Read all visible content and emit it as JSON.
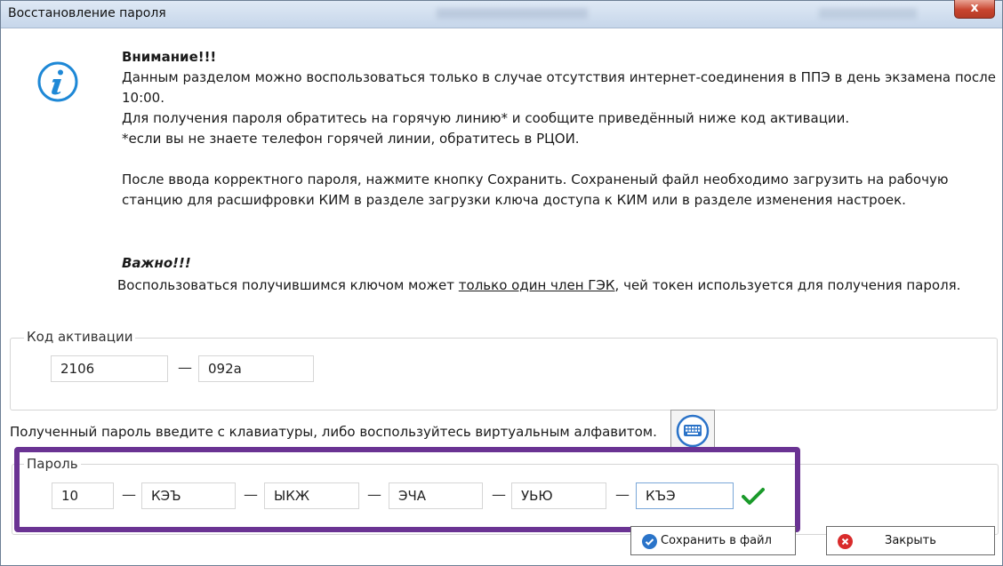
{
  "window": {
    "title": "Восстановление пароля",
    "close_glyph": "x"
  },
  "notice": {
    "heading": "Внимание!!!",
    "line1": "Данным разделом можно воспользоваться только в случае отсутствия интернет-соединения в ППЭ в день экзамена после",
    "line2": "10:00.",
    "line3": "Для получения пароля обратитесь на горячую линию* и сообщите приведённый ниже код активации.",
    "line4": "*если вы не знаете телефон горячей линии, обратитесь в РЦОИ.",
    "line5": "После ввода корректного пароля, нажмите кнопку Сохранить. Сохраненый файл необходимо загрузить на рабочую",
    "line6": "станцию для расшифровки КИМ в разделе загрузки ключа доступа к КИМ или в разделе изменения настроек.",
    "important_heading": "Важно!!!",
    "important_pre": "Воспользоваться получившимся ключом может ",
    "important_link": "только один член ГЭК",
    "important_post": ", чей токен используется для получения пароля."
  },
  "activation": {
    "legend": "Код активации",
    "part1": "2106",
    "part2": "092a",
    "separator": "—"
  },
  "password_hint": "Полученный пароль введите с клавиатуры, либо воспользуйтесь виртуальным алфавитом.",
  "password": {
    "legend": "Пароль",
    "separator": "—",
    "parts": [
      "10",
      "КЭЪ",
      "ЫКЖ",
      "ЭЧА",
      "УЬЮ",
      "КЪЭ"
    ],
    "valid": true
  },
  "buttons": {
    "save_label": "Сохранить в файл",
    "close_label": "Закрыть"
  },
  "colors": {
    "highlight": "#6a3393",
    "info_icon": "#1e88d6",
    "check": "#1a9a2a",
    "close_icon": "#d92b2b",
    "save_icon": "#2a74c9"
  },
  "icons": [
    "info-icon",
    "keyboard-icon",
    "check-icon",
    "save-icon",
    "close-icon"
  ]
}
